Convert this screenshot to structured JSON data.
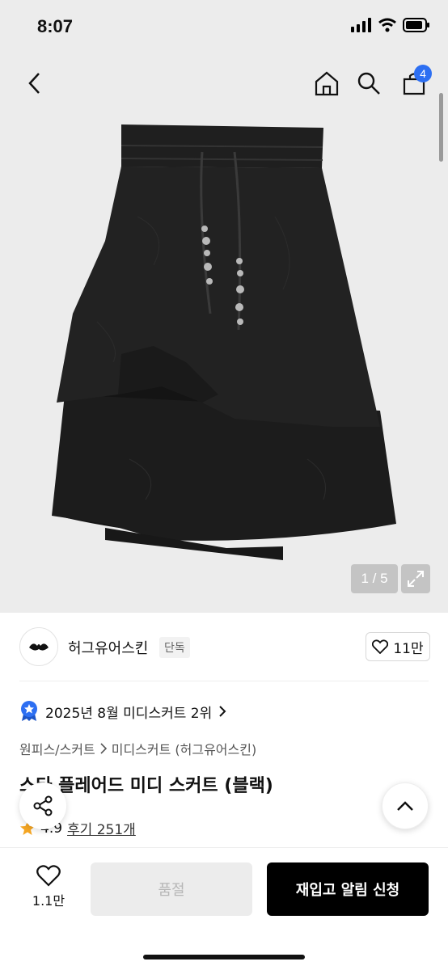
{
  "status_bar": {
    "time": "8:07"
  },
  "nav": {
    "cart_count": "4"
  },
  "gallery": {
    "pager": "1 / 5"
  },
  "brand": {
    "name": "허그유어스킨",
    "tag": "단독",
    "likes": "11만"
  },
  "ranking": {
    "text": "2025년 8월 미디스커트 2위"
  },
  "breadcrumb": {
    "category": "원피스/스커트",
    "sub": "미디스커트 (허그유어스킨)"
  },
  "product": {
    "title": "스타 플레어드 미디 스커트 (블랙)",
    "rating": "4.9",
    "reviews": "후기 251개"
  },
  "bottom_bar": {
    "wish_count": "1.1만",
    "soldout_label": "품절",
    "restock_label": "재입고 알림 신청"
  },
  "colors": {
    "accent": "#2d6ff2",
    "star": "#f5a623",
    "primary_button": "#000000"
  }
}
